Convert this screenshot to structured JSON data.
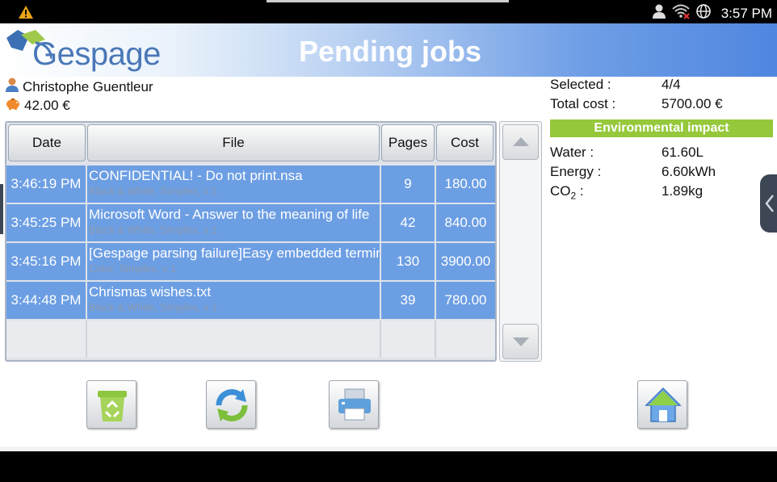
{
  "status_bar": {
    "time": "3:57 PM",
    "icons": [
      "warning-icon",
      "user-icon",
      "wifi-off-icon",
      "globe-icon"
    ]
  },
  "header": {
    "logo_text": "Gespage",
    "title": "Pending jobs"
  },
  "user": {
    "name": "Christophe Guentleur",
    "balance": "42.00 €"
  },
  "summary": {
    "selected_label": "Selected :",
    "selected_value": "4/4",
    "total_cost_label": "Total cost :",
    "total_cost_value": "5700.00 €"
  },
  "environment": {
    "title": "Environmental impact",
    "water_label": "Water :",
    "water_value": "61.60L",
    "energy_label": "Energy :",
    "energy_value": "6.60kWh",
    "co2_label_main": "CO",
    "co2_label_sub": "2",
    "co2_label_tail": " :",
    "co2_value": "1.89kg"
  },
  "table": {
    "headers": {
      "date": "Date",
      "file": "File",
      "pages": "Pages",
      "cost": "Cost"
    },
    "rows": [
      {
        "time": "3:46:19 PM",
        "file": "CONFIDENTIAL! - Do not print.nsa",
        "desc": "Black & White, Simplex, x 1",
        "pages": "9",
        "cost": "180.00"
      },
      {
        "time": "3:45:25 PM",
        "file": "Microsoft Word - Answer to the meaning of life",
        "desc": "Black & White, Simplex, x 1",
        "pages": "42",
        "cost": "840.00"
      },
      {
        "time": "3:45:16 PM",
        "file": "[Gespage parsing failure]Easy embedded terminal",
        "desc": "Color, Simplex, x 1",
        "pages": "130",
        "cost": "3900.00"
      },
      {
        "time": "3:44:48 PM",
        "file": "Chrismas wishes.txt",
        "desc": "Black & White, Simplex, x 1",
        "pages": "39",
        "cost": "780.00"
      }
    ]
  },
  "colors": {
    "row_selected": "#6c9ee3",
    "env_green": "#95c83a",
    "header_blue": "#4f86df"
  }
}
